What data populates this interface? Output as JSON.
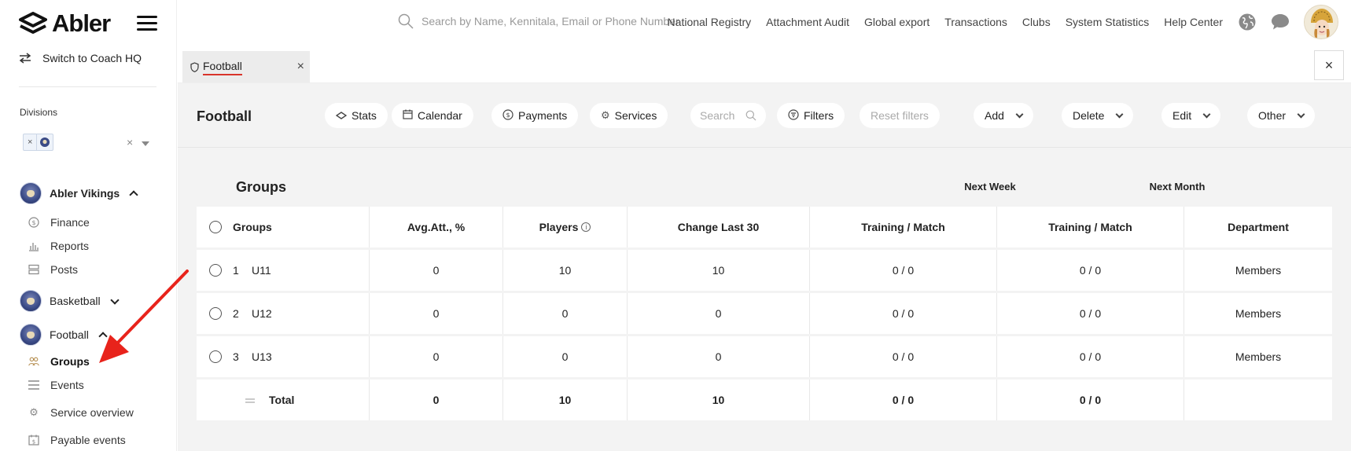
{
  "sidebar": {
    "logo_text": "Abler",
    "switch_label": "Switch to Coach HQ",
    "divisions_label": "Divisions",
    "division_chip_remove": "×",
    "division_clear": "×",
    "clubs": [
      {
        "name": "Abler Vikings",
        "items": [
          "Finance",
          "Reports",
          "Posts"
        ]
      },
      {
        "name": "Basketball"
      },
      {
        "name": "Football",
        "items": [
          "Groups",
          "Events",
          "Service overview",
          "Payable events"
        ]
      }
    ]
  },
  "topbar": {
    "search_placeholder": "Search by Name, Kennitala, Email or Phone Number",
    "nav": [
      "National Registry",
      "Attachment Audit",
      "Global export",
      "Transactions",
      "Clubs",
      "System Statistics",
      "Help Center"
    ]
  },
  "tabs": {
    "active_label": "Football",
    "close": "×",
    "close_all": "×"
  },
  "toolbar": {
    "title": "Football",
    "stats": "Stats",
    "calendar": "Calendar",
    "payments": "Payments",
    "services": "Services",
    "search_placeholder": "Search",
    "filters": "Filters",
    "reset_filters": "Reset filters",
    "add": "Add",
    "delete": "Delete",
    "edit": "Edit",
    "other": "Other"
  },
  "table": {
    "heading": "Groups",
    "next_week": "Next Week",
    "next_month": "Next Month",
    "columns": [
      "Groups",
      "Avg.Att., %",
      "Players",
      "Change Last 30",
      "Training / Match",
      "Training / Match",
      "Department"
    ],
    "rows": [
      {
        "num": "1",
        "group": "U11",
        "avg": "0",
        "players": "10",
        "change": "10",
        "week": "0 / 0",
        "month": "0 / 0",
        "dept": "Members"
      },
      {
        "num": "2",
        "group": "U12",
        "avg": "0",
        "players": "0",
        "change": "0",
        "week": "0 / 0",
        "month": "0 / 0",
        "dept": "Members"
      },
      {
        "num": "3",
        "group": "U13",
        "avg": "0",
        "players": "0",
        "change": "0",
        "week": "0 / 0",
        "month": "0 / 0",
        "dept": "Members"
      }
    ],
    "total": {
      "label": "Total",
      "avg": "0",
      "players": "10",
      "change": "10",
      "week": "0 / 0",
      "month": "0 / 0"
    }
  },
  "colors": {
    "accent_red": "#d9342b",
    "arrow_red": "#e8231b",
    "background": "#f3f3f3"
  }
}
